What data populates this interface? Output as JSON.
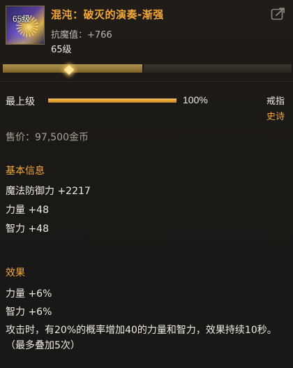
{
  "item": {
    "icon_level": "65级",
    "name": "混沌：破灭的演奏-渐强",
    "resist_label": "抗魔值：",
    "resist_value": "+766",
    "required_level": "65级"
  },
  "enhance": {
    "label": "最上级",
    "progress_percent": 100,
    "progress_text": "100%"
  },
  "slot": {
    "type": "戒指",
    "rarity": "史诗"
  },
  "price": "售价：97,500金币",
  "basic_info": {
    "title": "基本信息",
    "stats": [
      "魔法防御力 +2217",
      "力量 +48",
      "智力 +48"
    ]
  },
  "effects": {
    "title": "效果",
    "stats": [
      "力量 +6%",
      "智力 +6%"
    ],
    "description": "攻击时，有20%的概率增加40的力量和智力，效果持续10秒。（最多叠加5次）"
  },
  "colors": {
    "name": "#f5a83a",
    "section_title": "#f5a83a",
    "rarity": "#f5a83a",
    "text": "#f0ece4",
    "muted": "#a9a498",
    "bar_fill": "#e0a83c"
  },
  "icons": {
    "share": "share-icon",
    "tab_marker": "diamond-marker-icon"
  }
}
